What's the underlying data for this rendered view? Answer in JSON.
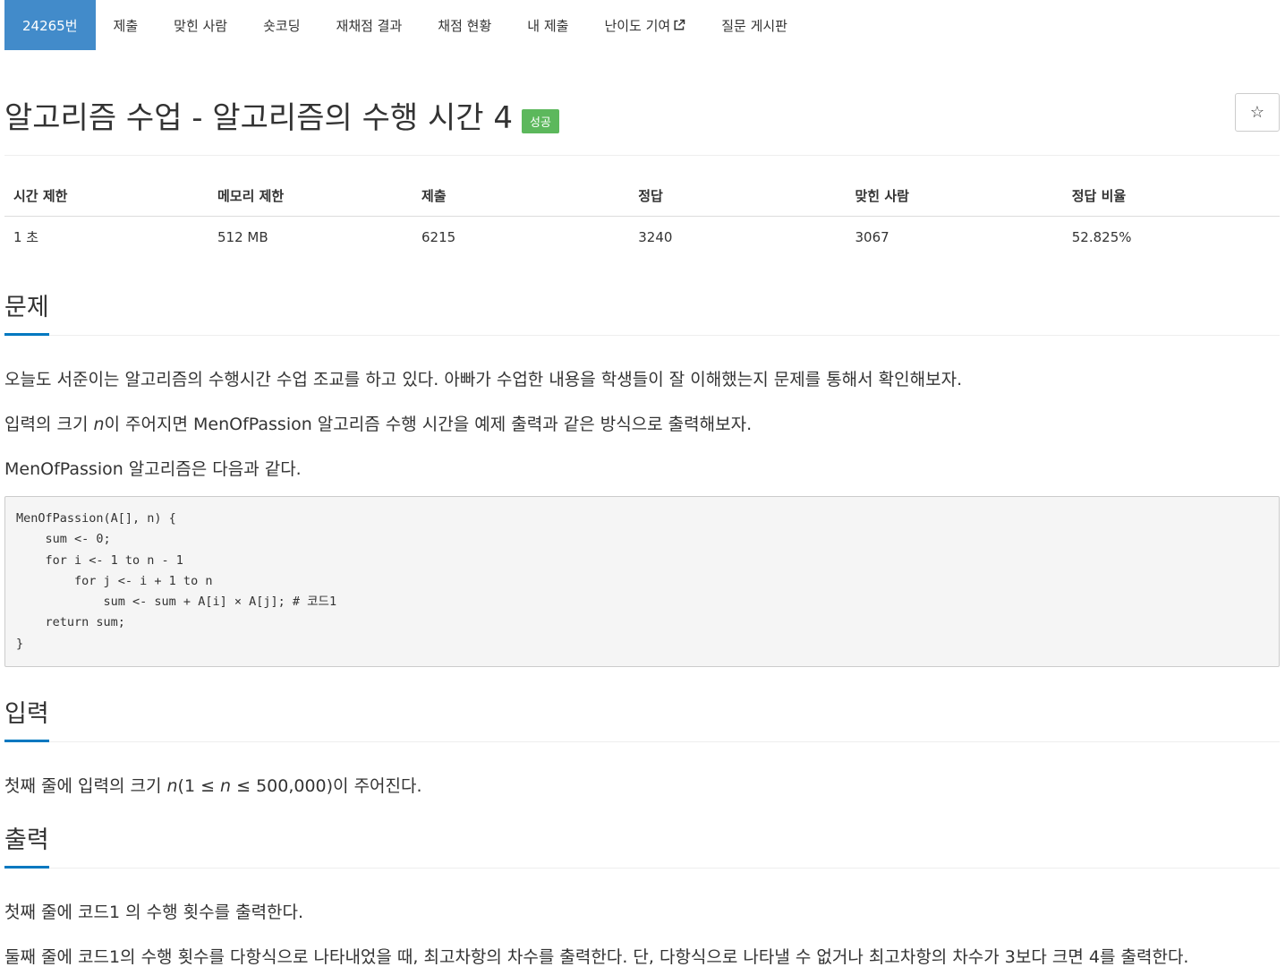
{
  "nav": {
    "tabs": [
      {
        "label": "24265번",
        "active": true
      },
      {
        "label": "제출"
      },
      {
        "label": "맞힌 사람"
      },
      {
        "label": "숏코딩"
      },
      {
        "label": "재채점 결과"
      },
      {
        "label": "채점 현황"
      },
      {
        "label": "내 제출"
      },
      {
        "label": "난이도 기여"
      },
      {
        "label": "질문 게시판"
      }
    ]
  },
  "problem": {
    "title": "알고리즘 수업 - 알고리즘의 수행 시간 4",
    "status_badge": "성공",
    "star_icon": "☆"
  },
  "info": {
    "headers": [
      "시간 제한",
      "메모리 제한",
      "제출",
      "정답",
      "맞힌 사람",
      "정답 비율"
    ],
    "values": [
      "1 초",
      "512 MB",
      "6215",
      "3240",
      "3067",
      "52.825%"
    ]
  },
  "sections": {
    "description": {
      "heading": "문제",
      "p1": "오늘도 서준이는 알고리즘의 수행시간 수업 조교를 하고 있다. 아빠가 수업한 내용을 학생들이 잘 이해했는지 문제를 통해서 확인해보자.",
      "p2_before": "입력의 크기 ",
      "p2_var": "n",
      "p2_after": "이 주어지면 MenOfPassion 알고리즘 수행 시간을 예제 출력과 같은 방식으로 출력해보자.",
      "p3": "MenOfPassion 알고리즘은 다음과 같다.",
      "code": "MenOfPassion(A[], n) {\n    sum <- 0;\n    for i <- 1 to n - 1\n        for j <- i + 1 to n\n            sum <- sum + A[i] × A[j]; # 코드1\n    return sum;\n}"
    },
    "input": {
      "heading": "입력",
      "p1_before": "첫째 줄에 입력의 크기 ",
      "p1_var1": "n",
      "p1_mid1": "(1 ≤ ",
      "p1_var2": "n",
      "p1_mid2": " ≤ 500,000)이 주어진다."
    },
    "output": {
      "heading": "출력",
      "p1": "첫째 줄에 코드1 의 수행 횟수를 출력한다.",
      "p2": "둘째 줄에 코드1의 수행 횟수를 다항식으로 나타내었을 때, 최고차항의 차수를 출력한다. 단, 다항식으로 나타낼 수 없거나 최고차항의 차수가 3보다 크면 4를 출력한다."
    }
  },
  "colors": {
    "active_tab": "#428bca",
    "success_badge": "#5cb85c",
    "section_underline": "#0078c0"
  }
}
